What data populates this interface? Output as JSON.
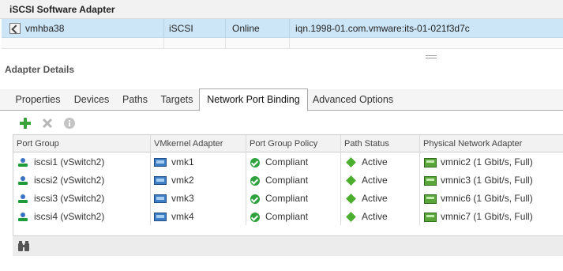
{
  "adapter_panel": {
    "title": "iSCSI Software Adapter",
    "adapter": {
      "name": "vmhba38",
      "type": "iSCSI",
      "status": "Online",
      "iqn": "iqn.1998-01.com.vmware:its-01-021f3d7c"
    }
  },
  "details": {
    "title": "Adapter Details",
    "tabs": [
      "Properties",
      "Devices",
      "Paths",
      "Targets",
      "Network Port Binding",
      "Advanced Options"
    ],
    "active_tab": "Network Port Binding",
    "toolbar": {
      "add_icon": "plus-icon",
      "remove_icon": "x-icon",
      "info_icon": "info-icon"
    },
    "grid": {
      "columns": [
        "Port Group",
        "VMkernel Adapter",
        "Port Group Policy",
        "Path Status",
        "Physical Network Adapter"
      ],
      "rows": [
        {
          "port_group": "iscsi1 (vSwitch2)",
          "vmk": "vmk1",
          "policy": "Compliant",
          "path_status": "Active",
          "nic": "vmnic2 (1 Gbit/s, Full)"
        },
        {
          "port_group": "iscsi2 (vSwitch2)",
          "vmk": "vmk2",
          "policy": "Compliant",
          "path_status": "Active",
          "nic": "vmnic3 (1 Gbit/s, Full)"
        },
        {
          "port_group": "iscsi3 (vSwitch2)",
          "vmk": "vmk3",
          "policy": "Compliant",
          "path_status": "Active",
          "nic": "vmnic6 (1 Gbit/s, Full)"
        },
        {
          "port_group": "iscsi4 (vSwitch2)",
          "vmk": "vmk4",
          "policy": "Compliant",
          "path_status": "Active",
          "nic": "vmnic7 (1 Gbit/s, Full)"
        }
      ]
    },
    "footer_icon": "binoculars-icon"
  },
  "colors": {
    "selection": "#cde6f7",
    "ok": "#2fa13f",
    "active": "#4cae2f",
    "add": "#3aa23a"
  }
}
